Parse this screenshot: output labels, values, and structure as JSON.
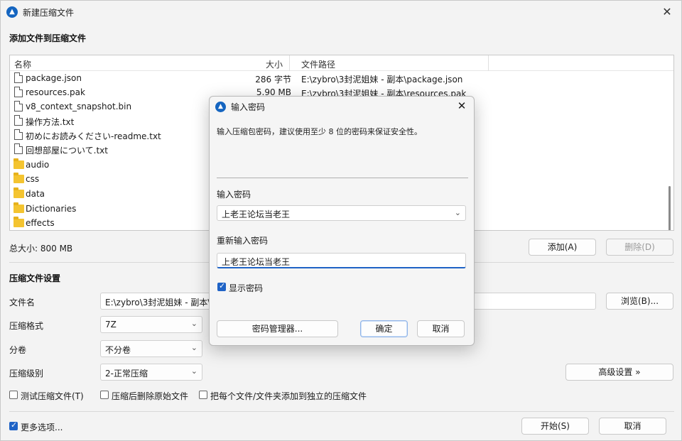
{
  "window": {
    "title": "新建压缩文件",
    "close_glyph": "✕"
  },
  "add_section": {
    "title": "添加文件到压缩文件"
  },
  "file_list": {
    "headers": {
      "name": "名称",
      "size": "大小",
      "path": "文件路径"
    },
    "rows": [
      {
        "name": "package.json",
        "size": "286 字节",
        "path": "E:\\zybro\\3封泥姐妹 - 副本\\package.json",
        "icon": "file-icon"
      },
      {
        "name": "resources.pak",
        "size": "5.90 MB",
        "path": "E:\\zybro\\3封泥姐妹 - 副本\\resources.pak",
        "icon": "file-icon"
      },
      {
        "name": "v8_context_snapshot.bin",
        "size": "",
        "path": "",
        "icon": "file-icon"
      },
      {
        "name": "操作方法.txt",
        "size": "",
        "path": "",
        "icon": "file-icon"
      },
      {
        "name": "初めにお読みください-readme.txt",
        "size": "",
        "path": "",
        "icon": "file-icon"
      },
      {
        "name": "回想部屋について.txt",
        "size": "",
        "path": "",
        "icon": "file-icon"
      },
      {
        "name": "audio",
        "size": "",
        "path": "",
        "icon": "folder-icon"
      },
      {
        "name": "css",
        "size": "",
        "path": "",
        "icon": "folder-icon"
      },
      {
        "name": "data",
        "size": "",
        "path": "",
        "icon": "folder-icon"
      },
      {
        "name": "Dictionaries",
        "size": "",
        "path": "",
        "icon": "folder-icon"
      },
      {
        "name": "effects",
        "size": "",
        "path": "",
        "icon": "folder-icon"
      }
    ]
  },
  "total_size": "总大小: 800 MB",
  "buttons": {
    "add": "添加(A)",
    "delete": "删除(D)",
    "browse": "浏览(B)...",
    "advanced": "高级设置 »",
    "start": "开始(S)",
    "cancel": "取消"
  },
  "settings": {
    "title": "压缩文件设置",
    "filename_label": "文件名",
    "filename_value": "E:\\zybro\\3封泥姐妹 - 副本\\3",
    "format_label": "压缩格式",
    "format_value": "7Z",
    "split_label": "分卷",
    "split_value": "不分卷",
    "level_label": "压缩级别",
    "level_value": "2-正常压缩"
  },
  "options": {
    "test": "测试压缩文件(T)",
    "delete_after": "压缩后删除原始文件",
    "separate": "把每个文件/文件夹添加到独立的压缩文件",
    "more": "更多选项..."
  },
  "dialog": {
    "title": "输入密码",
    "message": "输入压缩包密码，建议使用至少 8 位的密码来保证安全性。",
    "pw_label": "输入密码",
    "pw_value": "上老王论坛当老王",
    "confirm_label": "重新输入密码",
    "confirm_value": "上老王论坛当老王",
    "show_pw": "显示密码",
    "manager_btn": "密码管理器...",
    "ok_btn": "确定",
    "cancel_btn": "取消",
    "close_glyph": "✕"
  },
  "colors": {
    "accent": "#1f63c6",
    "icon_blue": "#1565c0",
    "folder": "#f4c430"
  }
}
